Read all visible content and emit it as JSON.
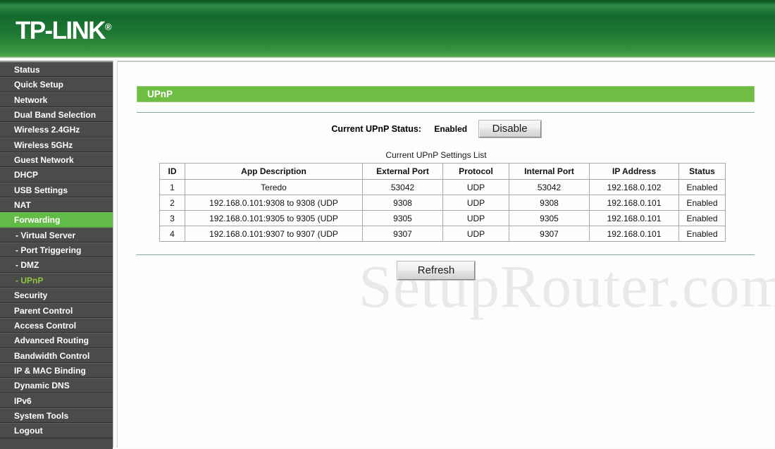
{
  "brand": {
    "name": "TP-LINK",
    "registered_mark": "®"
  },
  "sidebar": {
    "items": [
      {
        "label": "Status",
        "type": "main",
        "state": "normal"
      },
      {
        "label": "Quick Setup",
        "type": "main",
        "state": "normal"
      },
      {
        "label": "Network",
        "type": "main",
        "state": "normal"
      },
      {
        "label": "Dual Band Selection",
        "type": "main",
        "state": "normal"
      },
      {
        "label": "Wireless 2.4GHz",
        "type": "main",
        "state": "normal"
      },
      {
        "label": "Wireless 5GHz",
        "type": "main",
        "state": "normal"
      },
      {
        "label": "Guest Network",
        "type": "main",
        "state": "normal"
      },
      {
        "label": "DHCP",
        "type": "main",
        "state": "normal"
      },
      {
        "label": "USB Settings",
        "type": "main",
        "state": "normal"
      },
      {
        "label": "NAT",
        "type": "main",
        "state": "normal"
      },
      {
        "label": "Forwarding",
        "type": "main",
        "state": "active-main"
      },
      {
        "label": "- Virtual Server",
        "type": "sub",
        "state": "normal"
      },
      {
        "label": "- Port Triggering",
        "type": "sub",
        "state": "normal"
      },
      {
        "label": "- DMZ",
        "type": "sub",
        "state": "normal"
      },
      {
        "label": "- UPnP",
        "type": "sub",
        "state": "active-sub"
      },
      {
        "label": "Security",
        "type": "main",
        "state": "normal"
      },
      {
        "label": "Parent Control",
        "type": "main",
        "state": "normal"
      },
      {
        "label": "Access Control",
        "type": "main",
        "state": "normal"
      },
      {
        "label": "Advanced Routing",
        "type": "main",
        "state": "normal"
      },
      {
        "label": "Bandwidth Control",
        "type": "main",
        "state": "normal"
      },
      {
        "label": "IP & MAC Binding",
        "type": "main",
        "state": "normal"
      },
      {
        "label": "Dynamic DNS",
        "type": "main",
        "state": "normal"
      },
      {
        "label": "IPv6",
        "type": "main",
        "state": "normal"
      },
      {
        "label": "System Tools",
        "type": "main",
        "state": "normal"
      },
      {
        "label": "Logout",
        "type": "main",
        "state": "normal"
      }
    ]
  },
  "main": {
    "page_title": "UPnP",
    "watermark": "SetupRouter.com",
    "status": {
      "label": "Current UPnP Status:",
      "value": "Enabled",
      "toggle_button": "Disable"
    },
    "list_caption": "Current UPnP Settings List",
    "table": {
      "headers": [
        "ID",
        "App Description",
        "External Port",
        "Protocol",
        "Internal Port",
        "IP Address",
        "Status"
      ],
      "rows": [
        {
          "id": "1",
          "app_description": "Teredo",
          "external_port": "53042",
          "protocol": "UDP",
          "internal_port": "53042",
          "ip_address": "192.168.0.102",
          "status": "Enabled"
        },
        {
          "id": "2",
          "app_description": "192.168.0.101:9308 to 9308 (UDP",
          "external_port": "9308",
          "protocol": "UDP",
          "internal_port": "9308",
          "ip_address": "192.168.0.101",
          "status": "Enabled"
        },
        {
          "id": "3",
          "app_description": "192.168.0.101:9305 to 9305 (UDP",
          "external_port": "9305",
          "protocol": "UDP",
          "internal_port": "9305",
          "ip_address": "192.168.0.101",
          "status": "Enabled"
        },
        {
          "id": "4",
          "app_description": "192.168.0.101:9307 to 9307 (UDP",
          "external_port": "9307",
          "protocol": "UDP",
          "internal_port": "9307",
          "ip_address": "192.168.0.101",
          "status": "Enabled"
        }
      ]
    },
    "refresh_button": "Refresh"
  },
  "colors": {
    "brand_green_dark": "#14692c",
    "brand_green_light": "#4aa544",
    "title_bar_green": "#6ebe44",
    "sidebar_bg": "#4b4b4b",
    "sidebar_active_bg": "#62bb46",
    "sidebar_active_sub_text": "#8dc63f",
    "rule_green": "#8aa894",
    "watermark_gray": "#e9e9e9"
  }
}
